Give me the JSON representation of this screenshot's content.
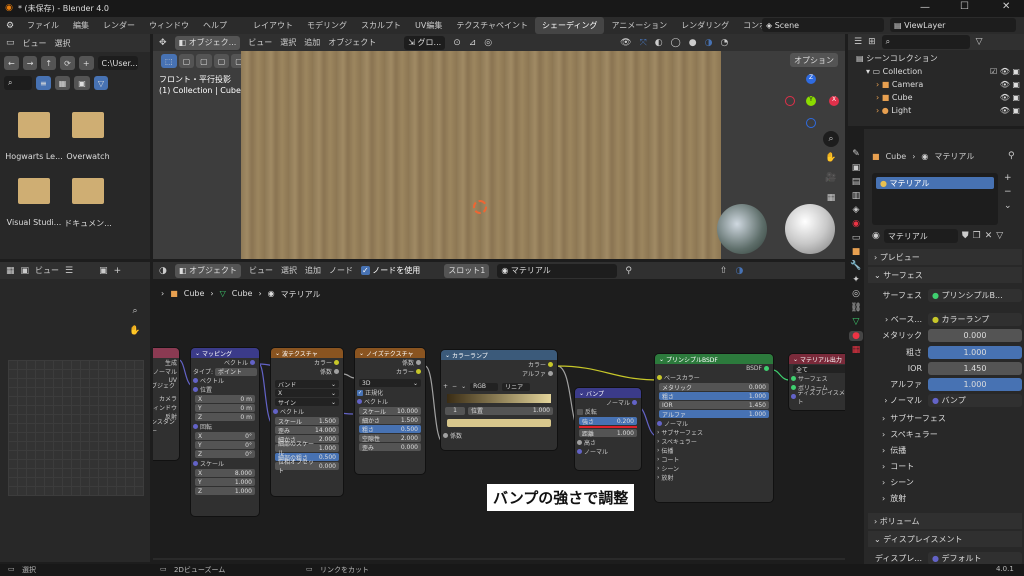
{
  "window": {
    "title": "* (未保存) - Blender 4.0"
  },
  "menu": [
    "ファイル",
    "編集",
    "レンダー",
    "ウィンドウ",
    "ヘルプ"
  ],
  "workspaces": [
    "レイアウト",
    "モデリング",
    "スカルプト",
    "UV編集",
    "テクスチャペイント",
    "シェーディング",
    "アニメーション",
    "レンダリング",
    "コンポジティング"
  ],
  "active_workspace": "シェーディング",
  "scene": "Scene",
  "viewlayer": "ViewLayer",
  "filebrowser": {
    "menu": [
      "ビュー",
      "選択"
    ],
    "path": "C:\\User...",
    "items": [
      "Hogwarts Le...",
      "Overwatch",
      "Visual Studi...",
      "ドキュメン..."
    ]
  },
  "viewport": {
    "mode": "オブジェク...",
    "menu": [
      "ビュー",
      "選択",
      "追加",
      "オブジェクト"
    ],
    "orient": "グロ...",
    "options": "オプション",
    "view_name": "フロント・平行投影",
    "collection": "(1) Collection | Cube",
    "axes": {
      "z": "Z",
      "y": "Y",
      "x": "X"
    }
  },
  "outliner": {
    "title": "シーンコレクション",
    "collection": "Collection",
    "items": [
      "Camera",
      "Cube",
      "Light"
    ]
  },
  "imageeditor": {
    "view": "ビュー"
  },
  "node_header": {
    "mode": "オブジェクト",
    "menu": [
      "ビュー",
      "選択",
      "追加",
      "ノード"
    ],
    "use_nodes": "ノードを使用",
    "slot": "スロット1",
    "material": "マテリアル"
  },
  "breadcrumb": [
    "Cube",
    "Cube",
    "マテリアル"
  ],
  "nodes": {
    "texcoord": {
      "rows": [
        "生成",
        "ノーマル",
        "UV",
        "オブジェクト",
        "カメラ",
        "ウィンドウ",
        "反射",
        "インスタンサー"
      ]
    },
    "mapping": {
      "title": "マッピング",
      "out": "ベクトル",
      "type_label": "タイプ:",
      "type": "ポイント",
      "vec": "ベクトル",
      "loc": "位置",
      "rot": "回転",
      "scale": "スケール",
      "loc_vals": [
        [
          "X",
          "0 m"
        ],
        [
          "Y",
          "0 m"
        ],
        [
          "Z",
          "0 m"
        ]
      ],
      "rot_vals": [
        [
          "X",
          "0°"
        ],
        [
          "Y",
          "0°"
        ],
        [
          "Z",
          "0°"
        ]
      ],
      "scale_vals": [
        [
          "X",
          "8.000"
        ],
        [
          "Y",
          "1.000"
        ],
        [
          "Z",
          "1.000"
        ]
      ]
    },
    "wave": {
      "title": "波テクスチャ",
      "outs": [
        "カラー",
        "係数"
      ],
      "type": "バンド",
      "axis": "X",
      "profile": "サイン",
      "vec": "ベクトル",
      "fields": [
        [
          "スケール",
          "1.500"
        ],
        [
          "歪み",
          "14.000"
        ],
        [
          "細かさ",
          "2.000"
        ],
        [
          "細部のスケール",
          "1.000"
        ],
        [
          "細部の粗さ",
          "0.500"
        ],
        [
          "位相オフセット",
          "0.000"
        ]
      ]
    },
    "noise": {
      "title": "ノイズテクスチャ",
      "outs": [
        "係数",
        "カラー"
      ],
      "dim": "3D",
      "normalize": "正規化",
      "vec": "ベクトル",
      "fields": [
        [
          "スケール",
          "10.000"
        ],
        [
          "細かさ",
          "1.500"
        ],
        [
          "粗さ",
          "0.500"
        ],
        [
          "空隙性",
          "2.000"
        ],
        [
          "歪み",
          "0.000"
        ]
      ]
    },
    "ramp": {
      "title": "カラーランプ",
      "outs": [
        "カラー",
        "アルファ"
      ],
      "mode": "RGB",
      "interp": "リニア",
      "index": "1",
      "pos_label": "位置",
      "pos": "1.000",
      "in": "係数"
    },
    "bump": {
      "title": "バンプ",
      "out": "ノーマル",
      "invert": "反転",
      "strength_label": "強さ",
      "strength": "0.200",
      "distance_label": "距離",
      "distance": "1.000",
      "height": "高さ",
      "normal": "ノーマル"
    },
    "bsdf": {
      "title": "プリンシプルBSDF",
      "out": "BSDF",
      "rows": [
        "ベースカラー"
      ],
      "fields": [
        [
          "メタリック",
          "0.000"
        ],
        [
          "粗さ",
          "1.000"
        ],
        [
          "IOR",
          "1.450"
        ],
        [
          "アルファ",
          "1.000"
        ]
      ],
      "normal": "ノーマル",
      "panels": [
        "サブサーフェス",
        "スペキュラー",
        "伝播",
        "コート",
        "シーン",
        "放射"
      ]
    },
    "output": {
      "title": "マテリアル出力",
      "target": "全て",
      "rows": [
        "サーフェス",
        "ボリューム",
        "ディスプレイスメント"
      ]
    }
  },
  "annotation": "バンプの強さで調整",
  "properties": {
    "object": "Cube",
    "material": "マテリアル",
    "slot": "マテリアル",
    "mat_name": "マテリアル",
    "preview": "プレビュー",
    "surface": "サーフェス",
    "surface_label": "サーフェス",
    "shader": "プリンシプルB...",
    "base": "ベース...",
    "base_val": "カラーランプ",
    "rows": [
      [
        "メタリック",
        "0.000"
      ],
      [
        "粗さ",
        "1.000"
      ],
      [
        "IOR",
        "1.450"
      ],
      [
        "アルファ",
        "1.000"
      ]
    ],
    "normal": "ノーマル",
    "normal_val": "バンプ",
    "panels": [
      "サブサーフェス",
      "スペキュラー",
      "伝播",
      "コート",
      "シーン",
      "放射"
    ],
    "volume": "ボリューム",
    "disp": "ディスプレイスメント",
    "disp_label": "ディスプレ...",
    "disp_val": "デフォルト"
  },
  "status": {
    "left": "選択",
    "mid": "2Dビューズーム",
    "right": "リンクをカット",
    "version": "4.0.1"
  }
}
